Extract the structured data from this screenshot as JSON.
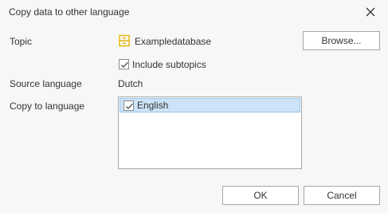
{
  "dialog": {
    "title": "Copy data to other language",
    "close_icon": "close-icon"
  },
  "form": {
    "topic_label": "Topic",
    "topic_icon": "database-icon",
    "topic_value": "Exampledatabase",
    "browse_button": "Browse...",
    "include_subtopics_label": "Include subtopics",
    "include_subtopics_checked": true,
    "source_language_label": "Source language",
    "source_language_value": "Dutch",
    "copy_to_language_label": "Copy to language",
    "languages": [
      {
        "label": "English",
        "checked": true,
        "selected": true
      }
    ]
  },
  "buttons": {
    "ok": "OK",
    "cancel": "Cancel"
  },
  "colors": {
    "selection_bg": "#cde3f7",
    "selection_border": "#99c6ec",
    "topic_icon": "#e8b400"
  }
}
